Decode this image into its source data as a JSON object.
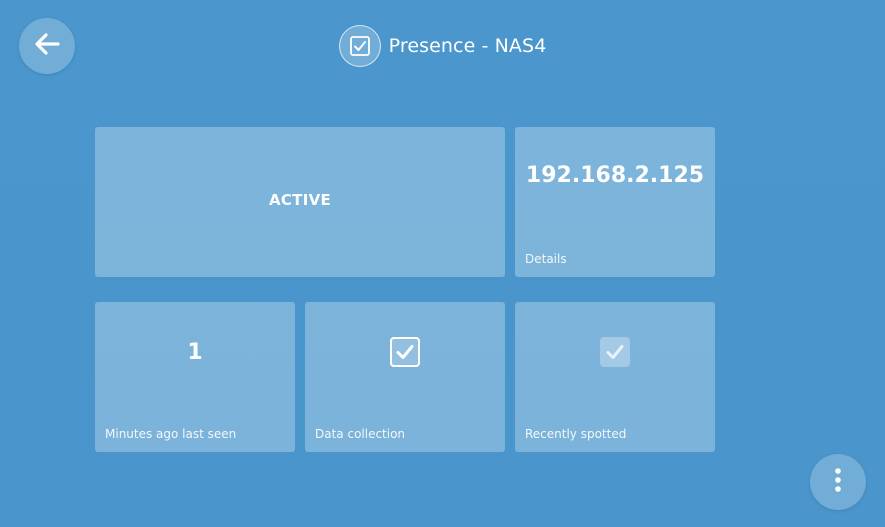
{
  "header": {
    "title": "Presence - NAS4",
    "icon": "checkbox-icon"
  },
  "navigation": {
    "back_icon": "arrow-left-icon",
    "menu_icon": "more-vertical-icon"
  },
  "tiles": {
    "status": {
      "value": "ACTIVE"
    },
    "ip": {
      "value": "192.168.2.125",
      "label": "Details"
    },
    "minutes": {
      "value": "1",
      "label": "Minutes ago last seen"
    },
    "data_collection": {
      "label": "Data collection",
      "checked": true
    },
    "recently_spotted": {
      "label": "Recently spotted",
      "checked": true,
      "faded": true
    }
  },
  "colors": {
    "background": "#4b97cd",
    "tile": "#7fb5db",
    "text": "#ffffff"
  }
}
